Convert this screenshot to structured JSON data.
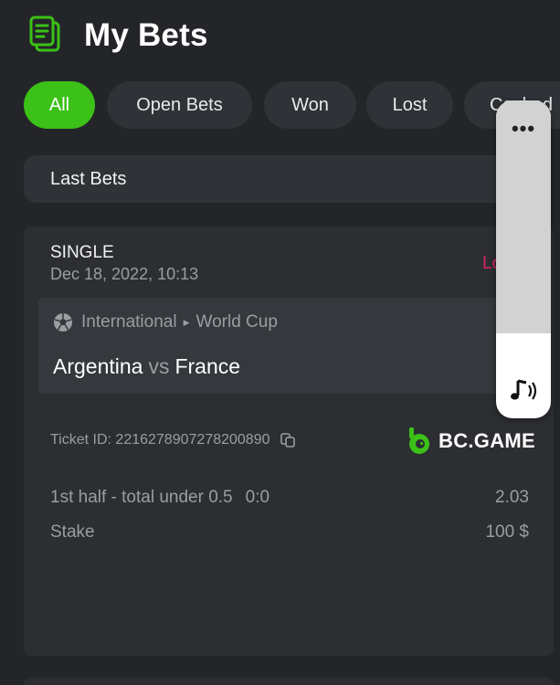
{
  "header": {
    "title": "My Bets",
    "icon": "bet-slip-icon"
  },
  "filters": [
    {
      "label": "All",
      "active": true
    },
    {
      "label": "Open Bets",
      "active": false
    },
    {
      "label": "Won",
      "active": false
    },
    {
      "label": "Lost",
      "active": false
    },
    {
      "label": "Cashed",
      "active": false
    }
  ],
  "section": {
    "title": "Last Bets"
  },
  "bet": {
    "type": "SINGLE",
    "date": "Dec 18, 2022, 10:13",
    "status": "Lost",
    "league": {
      "region": "International",
      "competition": "World Cup",
      "separator": "▶"
    },
    "home_team": "Argentina",
    "vs": "vs",
    "away_team": "France",
    "ticket_id": "Ticket ID: 2216278907278200890",
    "brand": "BC.GAME",
    "selection": "1st half - total under 0.5",
    "score": "0:0",
    "odds": "2.03",
    "stake_label": "Stake",
    "stake_value": "100 $"
  },
  "overlay": {
    "menu": "•••",
    "sound_icon": "music-note-icon"
  },
  "colors": {
    "accent": "#3bc117",
    "lost": "#e0215a",
    "background": "#232529",
    "card": "#2c2e32"
  }
}
